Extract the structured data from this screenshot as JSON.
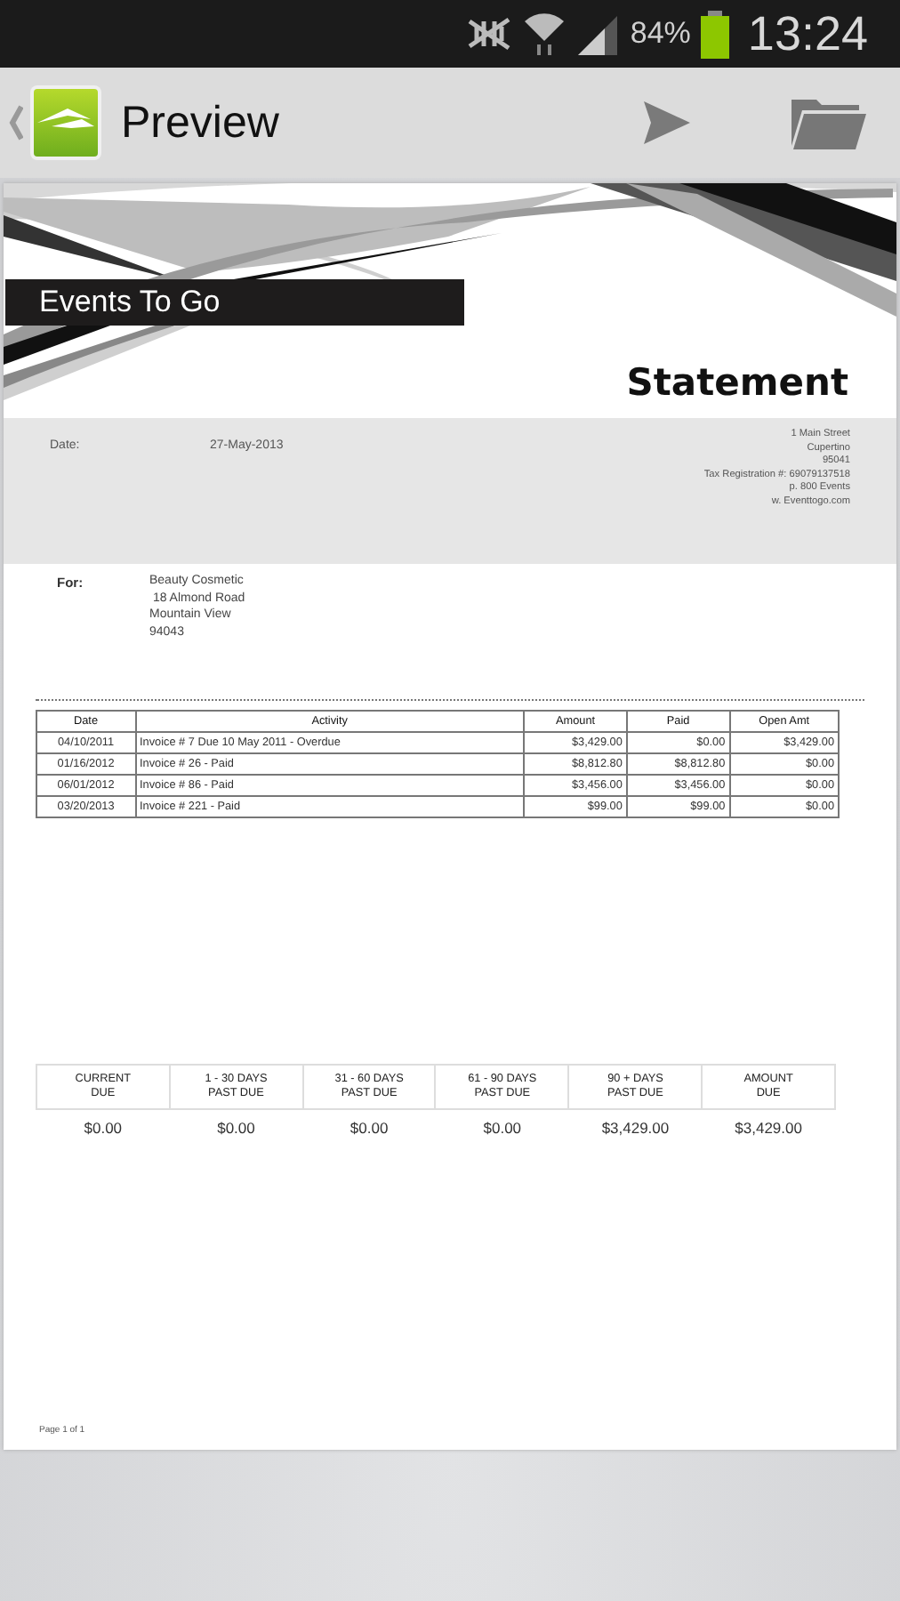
{
  "status_bar": {
    "battery": "84%",
    "time": "13:24"
  },
  "action_bar": {
    "title": "Preview"
  },
  "document": {
    "company": "Events To Go",
    "title": "Statement",
    "date_label": "Date:",
    "date": "27-May-2013",
    "address_lines": [
      "1 Main Street",
      "Cupertino",
      "95041",
      "Tax Registration #: 69079137518",
      "p. 800 Events",
      "w. Eventtogo.com"
    ],
    "for_label": "For:",
    "customer_lines": [
      "Beauty Cosmetic",
      " 18 Almond Road",
      "Mountain View",
      "94043"
    ],
    "transactions": {
      "columns": [
        "Date",
        "Activity",
        "Amount",
        "Paid",
        "Open Amt"
      ],
      "rows": [
        [
          "04/10/2011",
          "Invoice # 7 Due 10 May 2011 - Overdue",
          "$3,429.00",
          "$0.00",
          "$3,429.00"
        ],
        [
          "01/16/2012",
          "Invoice # 26 - Paid",
          "$8,812.80",
          "$8,812.80",
          "$0.00"
        ],
        [
          "06/01/2012",
          "Invoice # 86 - Paid",
          "$3,456.00",
          "$3,456.00",
          "$0.00"
        ],
        [
          "03/20/2013",
          "Invoice # 221 - Paid",
          "$99.00",
          "$99.00",
          "$0.00"
        ]
      ]
    },
    "aging": {
      "columns": [
        "CURRENT\nDUE",
        "1 - 30 DAYS\nPAST DUE",
        "31 - 60 DAYS\nPAST DUE",
        "61 - 90 DAYS\nPAST DUE",
        "90 + DAYS\nPAST DUE",
        "AMOUNT\nDUE"
      ],
      "values": [
        "$0.00",
        "$0.00",
        "$0.00",
        "$0.00",
        "$3,429.00",
        "$3,429.00"
      ]
    },
    "footer": "Page 1 of 1"
  }
}
